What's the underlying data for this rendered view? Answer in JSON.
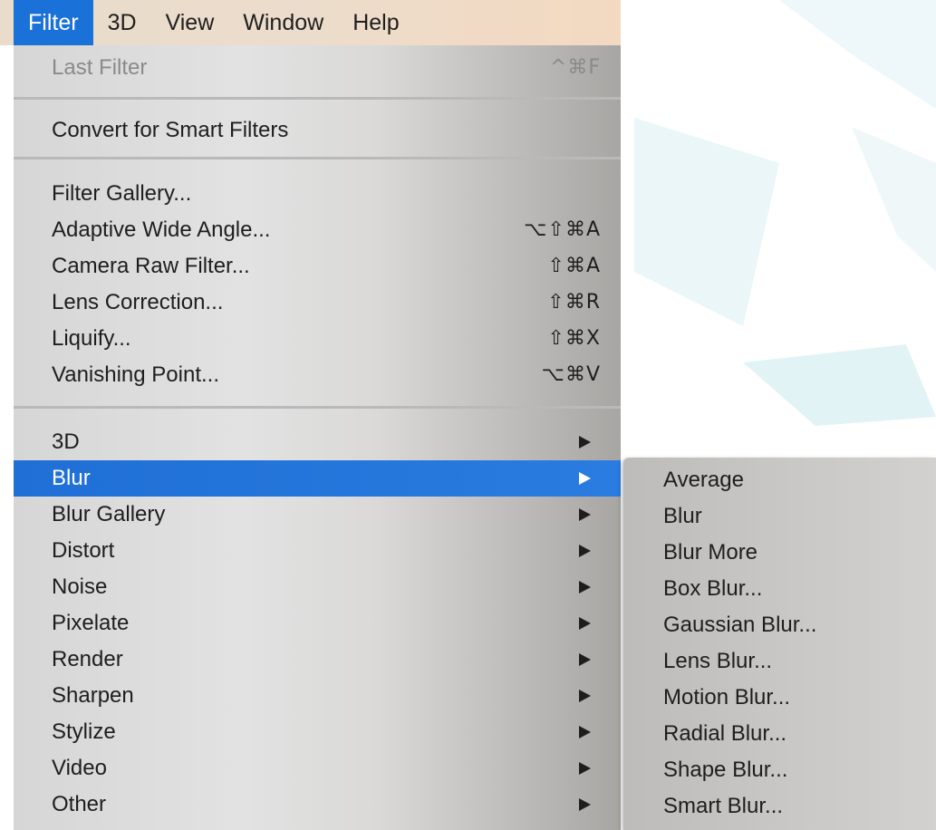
{
  "menubar": {
    "items": [
      "Filter",
      "3D",
      "View",
      "Window",
      "Help"
    ],
    "active_index": 0
  },
  "filter_menu": {
    "last_filter": {
      "label": "Last Filter",
      "shortcut": "^⌘F"
    },
    "convert_smart": {
      "label": "Convert for Smart Filters"
    },
    "filter_gallery": {
      "label": "Filter Gallery..."
    },
    "adaptive_wide_angle": {
      "label": "Adaptive Wide Angle...",
      "shortcut": "⌥⇧⌘A"
    },
    "camera_raw": {
      "label": "Camera Raw Filter...",
      "shortcut": "⇧⌘A"
    },
    "lens_correction": {
      "label": "Lens Correction...",
      "shortcut": "⇧⌘R"
    },
    "liquify": {
      "label": "Liquify...",
      "shortcut": "⇧⌘X"
    },
    "vanishing_point": {
      "label": "Vanishing Point...",
      "shortcut": "⌥⌘V"
    },
    "submenus": [
      "3D",
      "Blur",
      "Blur Gallery",
      "Distort",
      "Noise",
      "Pixelate",
      "Render",
      "Sharpen",
      "Stylize",
      "Video",
      "Other"
    ],
    "highlighted": "Blur"
  },
  "blur_submenu": {
    "items": [
      "Average",
      "Blur",
      "Blur More",
      "Box Blur...",
      "Gaussian Blur...",
      "Lens Blur...",
      "Motion Blur...",
      "Radial Blur...",
      "Shape Blur...",
      "Smart Blur..."
    ]
  },
  "colors": {
    "highlight": "#1a71d8",
    "menubar_bg": "#ecdccb",
    "background_shapes": "#e6f4f6"
  },
  "icons": {
    "submenu_arrow": "triangle-right-icon"
  }
}
